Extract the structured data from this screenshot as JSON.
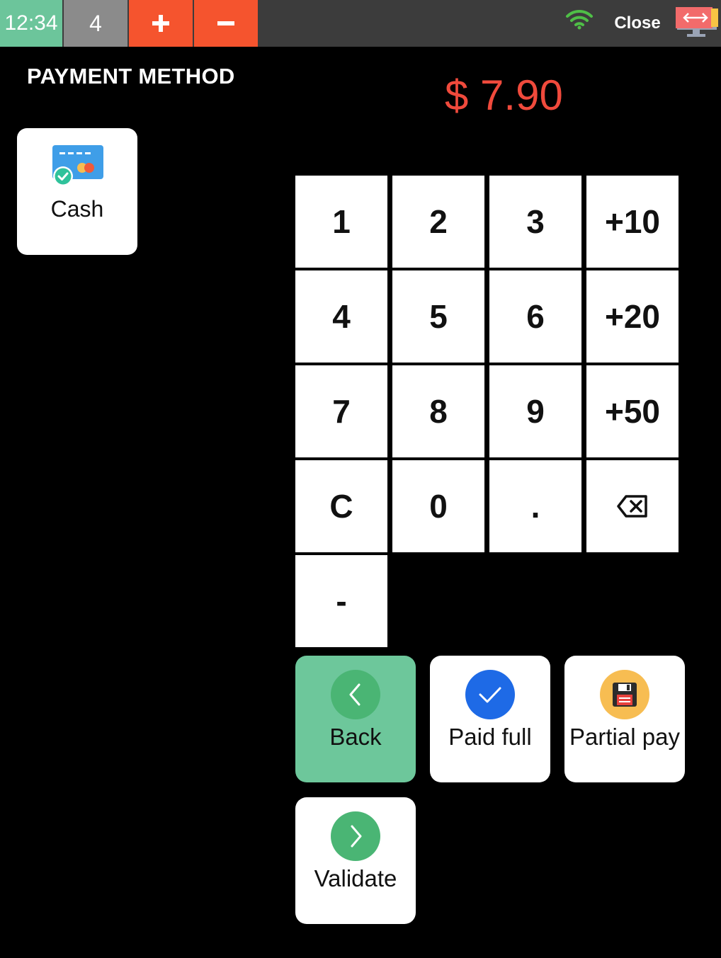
{
  "topbar": {
    "time": "12:34",
    "count": "4",
    "plus_icon": "plus-icon",
    "minus_icon": "minus-icon",
    "wifi_icon": "wifi-icon",
    "close_label": "Close",
    "screen_icon": "screen-switch-icon"
  },
  "page": {
    "title": "PAYMENT METHOD",
    "amount": "$ 7.90"
  },
  "payment_methods": [
    {
      "label": "Cash",
      "icon": "credit-card-icon"
    }
  ],
  "keypad": {
    "k1": "1",
    "k2": "2",
    "k3": "3",
    "kplus10": "+10",
    "k4": "4",
    "k5": "5",
    "k6": "6",
    "kplus20": "+20",
    "k7": "7",
    "k8": "8",
    "k9": "9",
    "kplus50": "+50",
    "kc": "C",
    "k0": "0",
    "kdot": ".",
    "kbackspace_icon": "backspace-icon",
    "kminus": "-"
  },
  "actions": {
    "back_label": "Back",
    "paid_full_label": "Paid full",
    "partial_pay_label": "Partial pay",
    "validate_label": "Validate"
  },
  "colors": {
    "time_bg": "#6cc59b",
    "count_bg": "#8b8b8b",
    "plus_minus_bg": "#f5542e",
    "amount": "#f04a3c",
    "back_bg": "#6dc79b",
    "green_circle": "#4ab574",
    "blue_circle": "#1e6ae6",
    "yellow_circle": "#f7bd52"
  }
}
